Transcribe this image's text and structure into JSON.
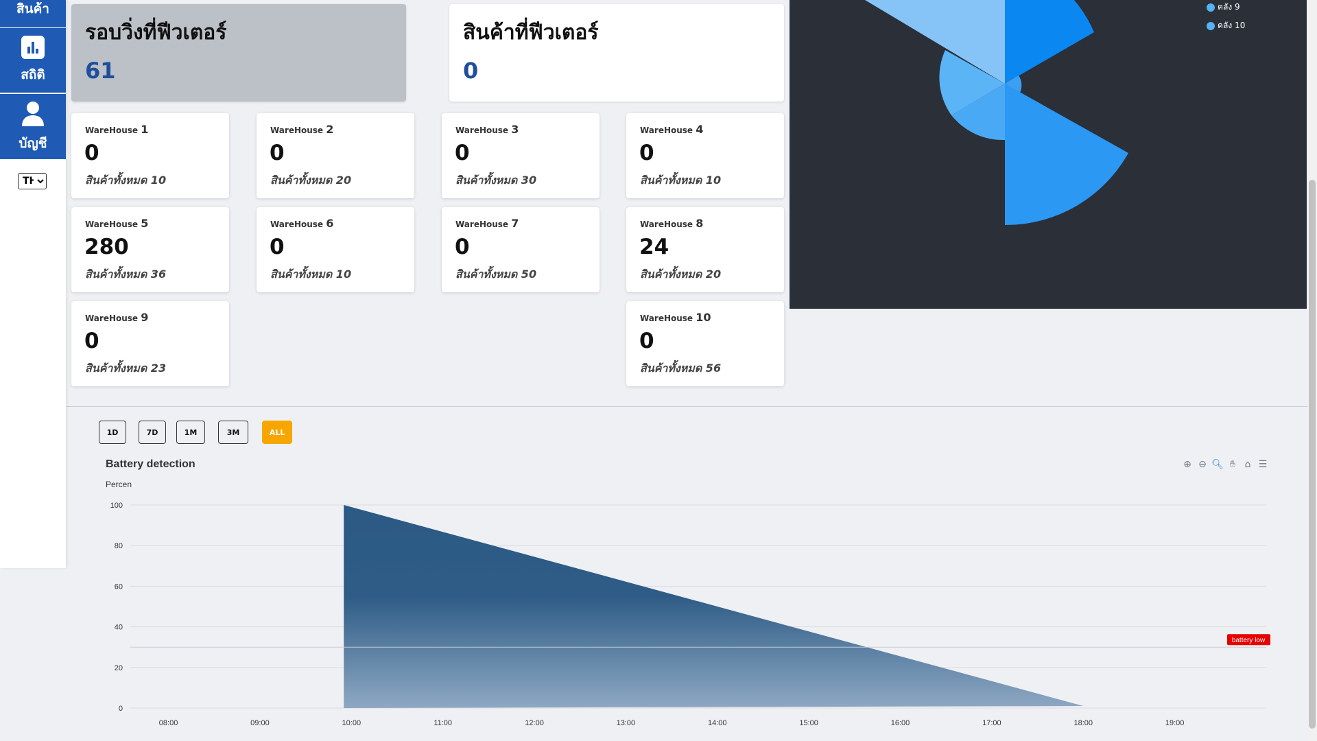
{
  "sidebar": {
    "top_item_label": "สินค้า",
    "stats_label": "สถิติ",
    "account_label": "บัญชี",
    "language": "TH",
    "language_options": [
      "TH"
    ]
  },
  "summary": {
    "laps_title": "รอบวิ่งที่ฟีวเตอร์",
    "laps_value": "61",
    "products_title": "สินค้าที่ฟีวเตอร์",
    "products_value": "0"
  },
  "warehouses": [
    {
      "prefix": "WareHouse",
      "num": "1",
      "count": "0",
      "total": "สินค้าทั้งหมด 10"
    },
    {
      "prefix": "WareHouse",
      "num": "2",
      "count": "0",
      "total": "สินค้าทั้งหมด 20"
    },
    {
      "prefix": "WareHouse",
      "num": "3",
      "count": "0",
      "total": "สินค้าทั้งหมด 30"
    },
    {
      "prefix": "WareHouse",
      "num": "4",
      "count": "0",
      "total": "สินค้าทั้งหมด 10"
    },
    {
      "prefix": "WareHouse",
      "num": "5",
      "count": "280",
      "total": "สินค้าทั้งหมด 36"
    },
    {
      "prefix": "WareHouse",
      "num": "6",
      "count": "0",
      "total": "สินค้าทั้งหมด 10"
    },
    {
      "prefix": "WareHouse",
      "num": "7",
      "count": "0",
      "total": "สินค้าทั้งหมด 50"
    },
    {
      "prefix": "WareHouse",
      "num": "8",
      "count": "24",
      "total": "สินค้าทั้งหมด 20"
    },
    {
      "prefix": "WareHouse",
      "num": "9",
      "count": "0",
      "total": "สินค้าทั้งหมด 23"
    },
    {
      "prefix": "WareHouse",
      "num": "10",
      "count": "0",
      "total": "สินค้าทั้งหมด 56"
    }
  ],
  "polar_legend": [
    "คลัง 9",
    "คลัง 10"
  ],
  "range_buttons": [
    "1D",
    "7D",
    "1M",
    "3M",
    "ALL"
  ],
  "active_range": "ALL",
  "toolbar_icons": [
    "zoom-in-icon",
    "zoom-out-icon",
    "zoom-select-icon",
    "pan-hand-icon",
    "home-reset-icon",
    "menu-icon"
  ],
  "colors": {
    "nav_blue": "#1f5bb5",
    "active_button": "#f7a600",
    "area_fill_top": "#2b5a85",
    "annotation": "#e60000",
    "polar_blue": "#57b1f5"
  },
  "chart_data": [
    {
      "type": "area",
      "title": "Battery detection",
      "ylabel": "Percen",
      "xlabel": "",
      "x_ticks": [
        "08:00",
        "09:00",
        "10:00",
        "11:00",
        "12:00",
        "13:00",
        "14:00",
        "15:00",
        "16:00",
        "17:00",
        "18:00",
        "19:00"
      ],
      "y_ticks": [
        0,
        20,
        40,
        60,
        80,
        100
      ],
      "ylim": [
        0,
        100
      ],
      "xlim": [
        "07:35",
        "20:00"
      ],
      "series": [
        {
          "values": [
            [
              "09:55",
              0
            ],
            [
              "09:55",
              100
            ],
            [
              "18:00",
              1
            ]
          ]
        }
      ],
      "annotation": {
        "label": "battery low",
        "y": 30
      },
      "grid": true
    },
    {
      "type": "pie",
      "variant": "polar-area",
      "legend": [
        "คลัง 9",
        "คลัง 10"
      ],
      "legend_position": "top-right"
    }
  ]
}
